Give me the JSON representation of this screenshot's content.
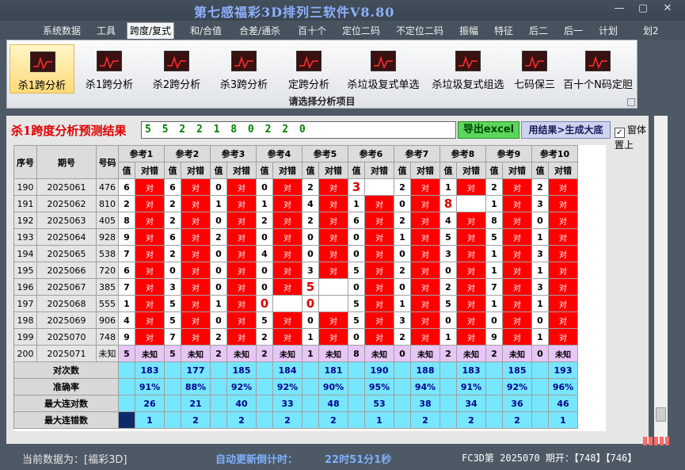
{
  "app_title": "第七感福彩3D排列三软件V8.80",
  "window_buttons": {
    "minimize": "—",
    "restore": "▢",
    "close": "✕"
  },
  "menu": [
    "系统数据",
    "工具",
    "跨度/复式",
    "和/合值",
    "合差/通杀",
    "百十个",
    "定位二码",
    "不定位二码",
    "振幅",
    "特征",
    "后二",
    "后一",
    "计划",
    "划2"
  ],
  "ribbon": {
    "buttons": [
      "杀1跨分析",
      "杀1跨分析",
      "杀2跨分析",
      "杀3跨分析",
      "定跨分析",
      "杀垃圾复式单选",
      "杀垃圾复式组选",
      "七码保三",
      "百十个N码定胆"
    ],
    "caption": "请选择分析项目"
  },
  "result": {
    "title": "杀1跨度分析预测结果",
    "value": "5 5 2 2 1 8 0 2 2 0",
    "export_label": "导出excel",
    "gen_label": "用结果>生成大底",
    "ontop_label": "窗体置上",
    "ontop_check": "✓"
  },
  "table": {
    "col_seq": "序号",
    "col_period": "期号",
    "col_code": "号码",
    "ref_headers": [
      "参考1",
      "参考2",
      "参考3",
      "参考4",
      "参考5",
      "参考6",
      "参考7",
      "参考8",
      "参考9",
      "参考10"
    ],
    "sub_val": "值",
    "sub_mark": "对错",
    "mark_right": "对",
    "rows": [
      {
        "seq": "190",
        "period": "2025061",
        "code": "476",
        "vals": [
          "6",
          "6",
          "0",
          "0",
          "2",
          "3",
          "2",
          "1",
          "2",
          "2"
        ],
        "right": [
          1,
          1,
          1,
          1,
          1,
          0,
          1,
          1,
          1,
          1
        ]
      },
      {
        "seq": "191",
        "period": "2025062",
        "code": "810",
        "vals": [
          "2",
          "2",
          "1",
          "1",
          "4",
          "1",
          "0",
          "8",
          "1",
          "3"
        ],
        "right": [
          1,
          1,
          1,
          1,
          1,
          1,
          1,
          0,
          1,
          1
        ]
      },
      {
        "seq": "192",
        "period": "2025063",
        "code": "405",
        "vals": [
          "8",
          "2",
          "0",
          "2",
          "2",
          "6",
          "2",
          "4",
          "8",
          "0"
        ],
        "right": [
          1,
          1,
          1,
          1,
          1,
          1,
          1,
          1,
          1,
          1
        ]
      },
      {
        "seq": "193",
        "period": "2025064",
        "code": "928",
        "vals": [
          "9",
          "6",
          "2",
          "0",
          "0",
          "0",
          "1",
          "5",
          "5",
          "1"
        ],
        "right": [
          1,
          1,
          1,
          1,
          1,
          1,
          1,
          1,
          1,
          1
        ]
      },
      {
        "seq": "194",
        "period": "2025065",
        "code": "538",
        "vals": [
          "7",
          "2",
          "0",
          "4",
          "0",
          "0",
          "0",
          "3",
          "1",
          "3"
        ],
        "right": [
          1,
          1,
          1,
          1,
          1,
          1,
          1,
          1,
          1,
          1
        ]
      },
      {
        "seq": "195",
        "period": "2025066",
        "code": "720",
        "vals": [
          "6",
          "0",
          "0",
          "0",
          "3",
          "5",
          "2",
          "0",
          "1",
          "1"
        ],
        "right": [
          1,
          1,
          1,
          1,
          1,
          1,
          1,
          1,
          1,
          1
        ]
      },
      {
        "seq": "196",
        "period": "2025067",
        "code": "385",
        "vals": [
          "7",
          "3",
          "0",
          "0",
          "5",
          "0",
          "0",
          "2",
          "7",
          "3"
        ],
        "right": [
          1,
          1,
          1,
          1,
          0,
          1,
          1,
          1,
          1,
          1
        ]
      },
      {
        "seq": "197",
        "period": "2025068",
        "code": "555",
        "vals": [
          "1",
          "5",
          "1",
          "0",
          "0",
          "5",
          "1",
          "5",
          "1",
          "1"
        ],
        "right": [
          1,
          1,
          1,
          0,
          0,
          1,
          1,
          1,
          1,
          1
        ]
      },
      {
        "seq": "198",
        "period": "2025069",
        "code": "906",
        "vals": [
          "4",
          "5",
          "0",
          "5",
          "0",
          "5",
          "3",
          "0",
          "0",
          "0"
        ],
        "right": [
          1,
          1,
          1,
          1,
          1,
          1,
          1,
          1,
          1,
          1
        ]
      },
      {
        "seq": "199",
        "period": "2025070",
        "code": "748",
        "vals": [
          "9",
          "7",
          "2",
          "2",
          "1",
          "0",
          "2",
          "1",
          "9",
          "1"
        ],
        "right": [
          1,
          1,
          1,
          1,
          1,
          1,
          1,
          1,
          1,
          1
        ]
      }
    ],
    "predict_row": {
      "seq": "200",
      "period": "2025071",
      "code": "未知",
      "vals": [
        "5",
        "5",
        "2",
        "2",
        "1",
        "8",
        "0",
        "2",
        "2",
        "0"
      ],
      "mark": "未知"
    },
    "stats": [
      {
        "label": "对次数",
        "values": [
          "183",
          "177",
          "185",
          "184",
          "181",
          "190",
          "188",
          "183",
          "185",
          "193"
        ]
      },
      {
        "label": "准确率",
        "values": [
          "91%",
          "88%",
          "92%",
          "92%",
          "90%",
          "95%",
          "94%",
          "91%",
          "92%",
          "96%"
        ]
      },
      {
        "label": "最大连对数",
        "values": [
          "26",
          "21",
          "40",
          "33",
          "48",
          "53",
          "38",
          "34",
          "36",
          "46"
        ]
      },
      {
        "label": "最大连错数",
        "values": [
          "1",
          "2",
          "2",
          "2",
          "2",
          "1",
          "2",
          "2",
          "2",
          "1"
        ]
      }
    ]
  },
  "status": {
    "current_label": "当前数据为：[福彩3D]",
    "countdown_label": "自动更新倒计时：",
    "countdown_value": "22时51分1秒",
    "draw_info": "FC3D第 2025070 期开：【748】【746】"
  },
  "colors": {
    "right_mark": "#ff0000",
    "predict_row": "#e7c6f6",
    "stat_row": "#77e6ff",
    "title_red": "#e00000",
    "result_green": "#008000"
  }
}
